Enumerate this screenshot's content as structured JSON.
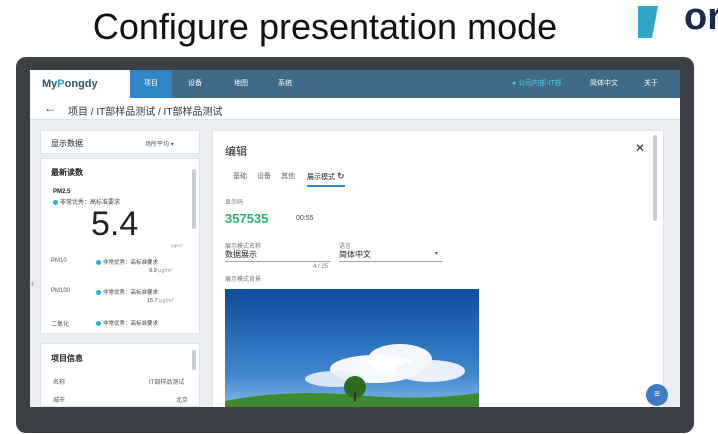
{
  "slide": {
    "title": "Configure presentation mode",
    "logo_text": "or"
  },
  "topbar": {
    "brand": {
      "prefix": "My",
      "arc": "P",
      "suffix": "ongdy"
    },
    "nav": [
      "项目",
      "设备",
      "地图",
      "系统"
    ],
    "user": "公司内部-IT部",
    "language": "简体中文",
    "about": "关于"
  },
  "breadcrumb": {
    "back_icon": "arrow-left-icon",
    "path": "项目 / IT部样品测试 / IT部样品测试"
  },
  "left": {
    "display_label": "显示数据",
    "display_select": "场所平均",
    "latest_title": "最新读数",
    "pm25": {
      "name": "PM2.5",
      "status": "非常优秀：高标准要求",
      "value": "5.4",
      "unit": "μg/m³"
    },
    "rows": [
      {
        "name": "PM10",
        "status": "非常优秀：高标准要求",
        "value": "9.9",
        "unit": "μg/m³"
      },
      {
        "name": "PM100",
        "status": "非常优秀：高标准要求",
        "value": "15.7",
        "unit": "μg/m³"
      },
      {
        "name": "二氧化",
        "status": "非常优秀：高标准要求"
      }
    ],
    "info_title": "项目信息",
    "info": [
      {
        "label": "名称",
        "value": "IT部样品测试"
      },
      {
        "label": "城市",
        "value": "北京"
      }
    ]
  },
  "editor": {
    "title": "编辑",
    "close_icon": "close-icon",
    "tabs": [
      "基础",
      "设备",
      "其他",
      "展示模式"
    ],
    "refresh_icon": "refresh-icon",
    "code_label": "显示码",
    "code": "357535",
    "timer": "00:55",
    "mode_name_label": "展示模式名称",
    "mode_name_value": "数据展示",
    "counter": "4 / 25",
    "language_label": "语言",
    "language_value": "简体中文",
    "background_label": "展示模式背景"
  },
  "fab_icon": "menu-icon"
}
